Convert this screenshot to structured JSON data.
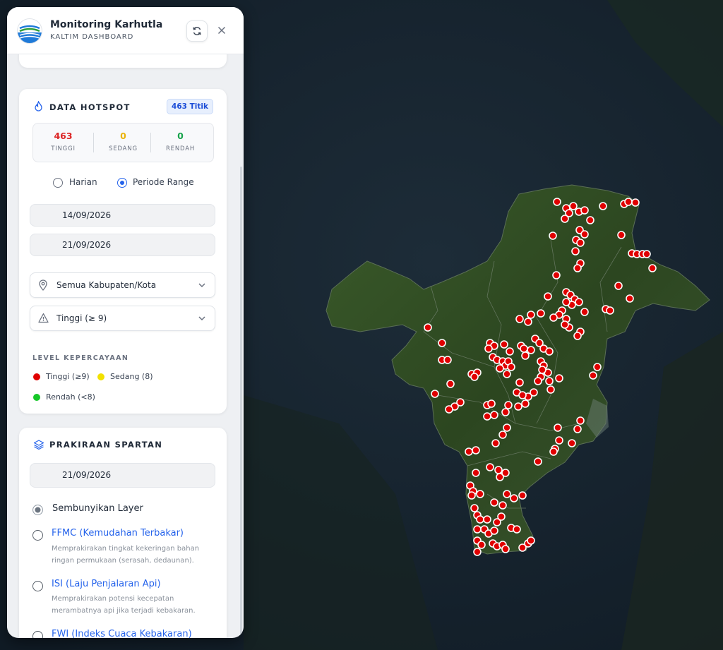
{
  "header": {
    "title": "Monitoring Karhutla",
    "subtitle": "KALTIM DASHBOARD"
  },
  "hotspot": {
    "title": "DATA HOTSPOT",
    "badge": "463 Titik",
    "stats": [
      {
        "value": "463",
        "label": "TINGGI",
        "color": "#dc2626"
      },
      {
        "value": "0",
        "label": "SEDANG",
        "color": "#eab308"
      },
      {
        "value": "0",
        "label": "RENDAH",
        "color": "#16a34a"
      }
    ],
    "mode_options": [
      "Harian",
      "Periode Range"
    ],
    "mode_selected": "Periode Range",
    "date_start": "14/09/2026",
    "date_end": "21/09/2026",
    "region_select": "Semua Kabupaten/Kota",
    "level_select": "Tinggi (≥ 9)",
    "legend_title": "LEVEL KEPERCAYAAN",
    "legend": [
      {
        "label": "Tinggi (≥9)",
        "color": "#e00000"
      },
      {
        "label": "Sedang (8)",
        "color": "#f2e100"
      },
      {
        "label": "Rendah (<8)",
        "color": "#16c728"
      }
    ]
  },
  "spartan": {
    "title": "PRAKIRAAN SPARTAN",
    "date": "21/09/2026",
    "options": [
      {
        "title": "Sembunyikan Layer",
        "desc": "",
        "selected": true
      },
      {
        "title": "FFMC (Kemudahan Terbakar)",
        "desc": "Memprakirakan tingkat kekeringan bahan ringan permukaan (serasah, dedaunan).",
        "selected": false
      },
      {
        "title": "ISI (Laju Penjalaran Api)",
        "desc": "Memprakirakan potensi kecepatan merambatnya api jika terjadi kebakaran.",
        "selected": false
      },
      {
        "title": "FWI (Indeks Cuaca Kebakaran)",
        "desc": "",
        "selected": false
      }
    ]
  },
  "map": {
    "hotspot_color": "#e00000",
    "land_color": "#2f4a22",
    "sea_color": "#14212d"
  }
}
